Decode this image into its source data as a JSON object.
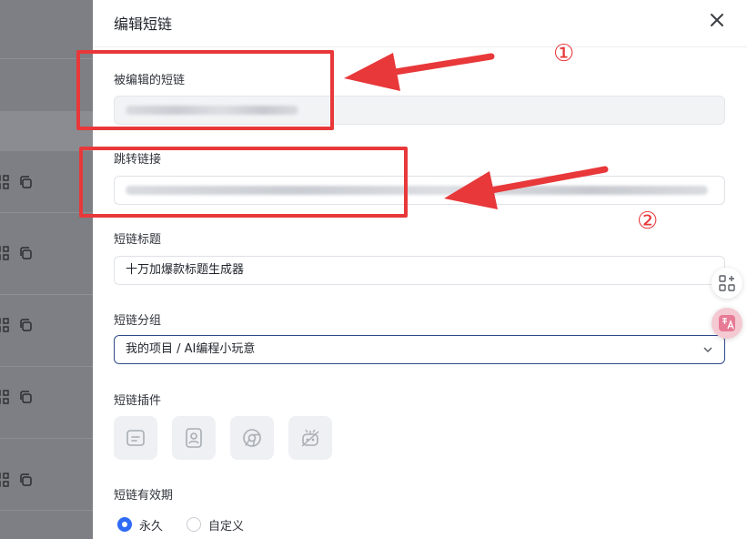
{
  "drawer": {
    "title": "编辑短链",
    "close_icon": "close-icon"
  },
  "fields": {
    "edited_short_link": {
      "label": "被编辑的短链"
    },
    "redirect_link": {
      "label": "跳转链接"
    },
    "title": {
      "label": "短链标题",
      "value": "十万加爆款标题生成器"
    },
    "group": {
      "label": "短链分组",
      "value": "我的项目 / AI编程小玩意"
    },
    "plugins": {
      "label": "短链插件",
      "icons": [
        "form-icon",
        "contact-card-icon",
        "chrome-icon",
        "robot-icon"
      ]
    },
    "validity": {
      "label": "短链有效期",
      "options": [
        {
          "label": "永久",
          "checked": true
        },
        {
          "label": "自定义",
          "checked": false
        }
      ]
    }
  },
  "annotations": {
    "marker_1": "①",
    "marker_2": "②",
    "color": "#e8383a"
  },
  "colors": {
    "accent": "#2f6bf5",
    "backdrop": "#7d7f84"
  }
}
